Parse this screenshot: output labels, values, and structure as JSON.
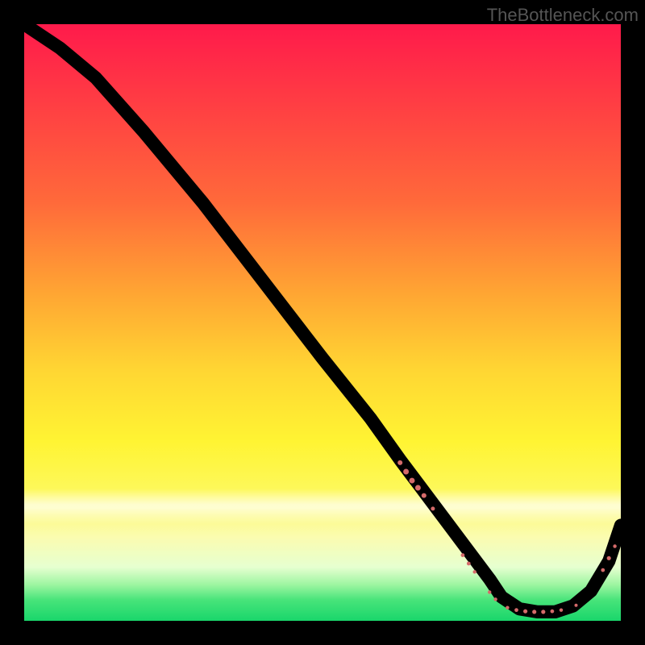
{
  "watermark": "TheBottleneck.com",
  "colors": {
    "dot": "#d46a6a",
    "line": "#000000"
  },
  "chart_data": {
    "type": "line",
    "title": "",
    "xlabel": "",
    "ylabel": "",
    "xlim": [
      0,
      100
    ],
    "ylim": [
      0,
      100
    ],
    "grid": false,
    "series": [
      {
        "name": "bottleneck-curve",
        "x": [
          0,
          6,
          12,
          20,
          30,
          40,
          50,
          58,
          63,
          66,
          69,
          72,
          75,
          78,
          80,
          83,
          86,
          89,
          92,
          95,
          98,
          100
        ],
        "y": [
          100,
          96,
          91,
          82,
          70,
          57,
          44,
          34,
          27,
          23,
          19,
          15,
          11,
          7,
          4,
          2,
          1.5,
          1.5,
          2.5,
          5,
          10,
          16
        ]
      }
    ],
    "dot_clusters": [
      {
        "cx": 63.0,
        "cy": 26.5,
        "r": 3.0
      },
      {
        "cx": 64.0,
        "cy": 25.0,
        "r": 3.5
      },
      {
        "cx": 65.0,
        "cy": 23.5,
        "r": 3.5
      },
      {
        "cx": 66.0,
        "cy": 22.3,
        "r": 3.5
      },
      {
        "cx": 67.0,
        "cy": 21.0,
        "r": 3.0
      },
      {
        "cx": 68.5,
        "cy": 18.8,
        "r": 2.5
      },
      {
        "cx": 73.5,
        "cy": 11.0,
        "r": 2.4
      },
      {
        "cx": 74.5,
        "cy": 9.6,
        "r": 2.4
      },
      {
        "cx": 75.5,
        "cy": 8.2,
        "r": 2.2
      },
      {
        "cx": 78.0,
        "cy": 4.8,
        "r": 2.2
      },
      {
        "cx": 79.0,
        "cy": 3.6,
        "r": 2.2
      },
      {
        "cx": 81.0,
        "cy": 2.2,
        "r": 2.2
      },
      {
        "cx": 82.5,
        "cy": 1.8,
        "r": 2.4
      },
      {
        "cx": 84.0,
        "cy": 1.6,
        "r": 2.6
      },
      {
        "cx": 85.5,
        "cy": 1.5,
        "r": 2.6
      },
      {
        "cx": 87.0,
        "cy": 1.5,
        "r": 2.6
      },
      {
        "cx": 88.5,
        "cy": 1.6,
        "r": 2.4
      },
      {
        "cx": 90.0,
        "cy": 1.8,
        "r": 2.2
      },
      {
        "cx": 92.5,
        "cy": 2.6,
        "r": 2.0
      },
      {
        "cx": 97.0,
        "cy": 8.5,
        "r": 2.4
      },
      {
        "cx": 98.0,
        "cy": 10.5,
        "r": 2.6
      },
      {
        "cx": 99.0,
        "cy": 12.5,
        "r": 2.2
      }
    ]
  }
}
